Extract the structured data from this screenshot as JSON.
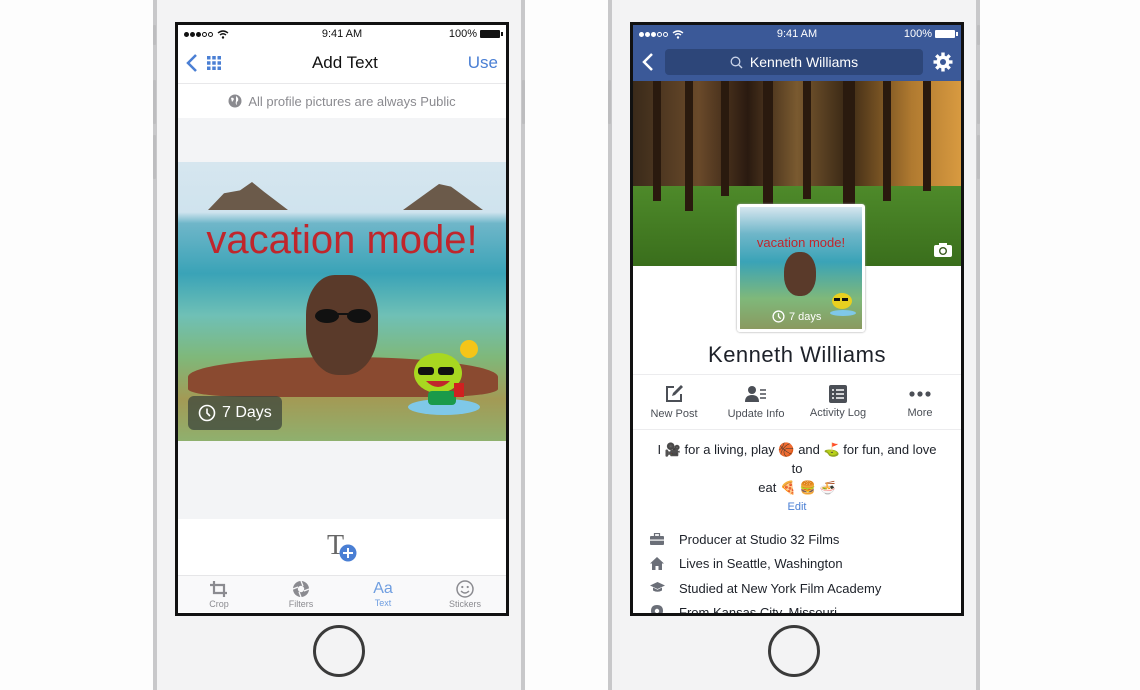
{
  "left_phone": {
    "status": {
      "time": "9:41 AM",
      "battery": "100%"
    },
    "nav": {
      "title": "Add Text",
      "use_label": "Use",
      "back_icon": "chevron-left-icon",
      "grid_icon": "grid-icon"
    },
    "privacy_note": "All profile pictures are always Public",
    "photo": {
      "caption": "vacation mode!",
      "timer_label": "7 Days"
    },
    "tabs": [
      {
        "label": "Crop",
        "icon": "crop-icon",
        "active": false
      },
      {
        "label": "Filters",
        "icon": "aperture-icon",
        "active": false
      },
      {
        "label": "Text",
        "icon": "text-aa-icon",
        "glyph": "Aa",
        "active": true
      },
      {
        "label": "Stickers",
        "icon": "smiley-icon",
        "active": false
      }
    ],
    "add_text_glyph": "T"
  },
  "right_phone": {
    "status": {
      "time": "9:41 AM",
      "battery": "100%"
    },
    "search": {
      "value": "Kenneth Williams"
    },
    "profile": {
      "picture_caption": "vacation mode!",
      "picture_timer": "7 days",
      "name": "Kenneth Williams"
    },
    "actions": [
      {
        "label": "New Post",
        "icon": "compose-icon"
      },
      {
        "label": "Update Info",
        "icon": "update-info-icon"
      },
      {
        "label": "Activity Log",
        "icon": "list-icon"
      },
      {
        "label": "More",
        "icon": "more-dots-icon"
      }
    ],
    "bio": {
      "line1": "I 🎥 for a living, play 🏀 and ⛳ for fun, and love to",
      "line2": "eat 🍕 🍔 🍜",
      "edit_label": "Edit"
    },
    "info": [
      {
        "icon": "briefcase-icon",
        "text": "Producer at Studio 32 Films"
      },
      {
        "icon": "home-icon",
        "text": "Lives in Seattle, Washington"
      },
      {
        "icon": "graduation-cap-icon",
        "text": "Studied at New York Film Academy"
      },
      {
        "icon": "location-pin-icon",
        "text": "From Kansas City, Missouri"
      }
    ]
  },
  "colors": {
    "facebook_blue": "#3b5998",
    "ios_blue": "#4a7fd4",
    "caption_red": "#c0262c"
  }
}
